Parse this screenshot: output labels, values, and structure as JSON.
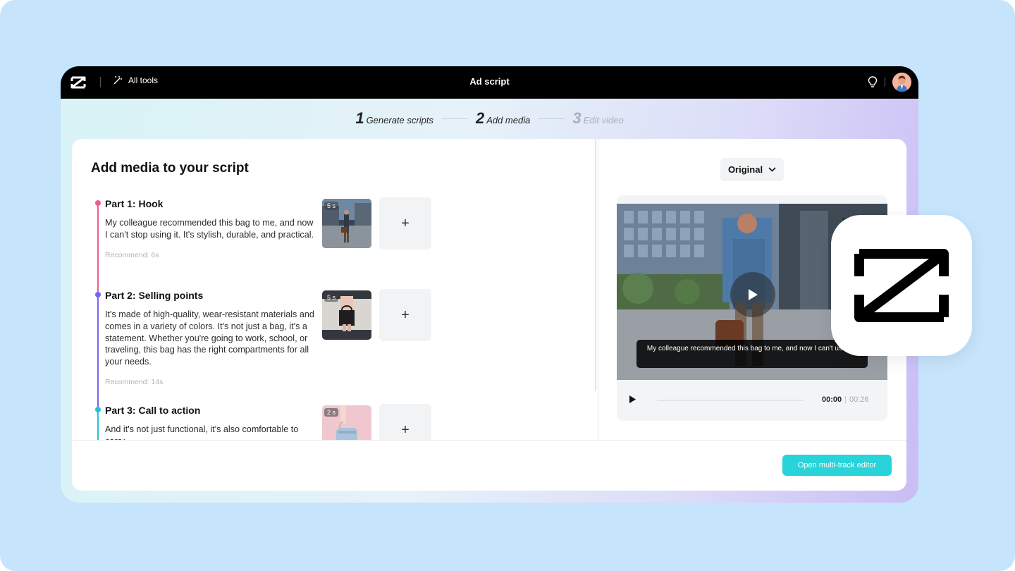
{
  "topbar": {
    "all_tools_label": "All tools",
    "title": "Ad script"
  },
  "steps": [
    {
      "number": "1",
      "label": "Generate scripts",
      "state": "done"
    },
    {
      "number": "2",
      "label": "Add media",
      "state": "active"
    },
    {
      "number": "3",
      "label": "Edit video",
      "state": "inactive"
    }
  ],
  "main": {
    "heading": "Add media to your script",
    "parts": [
      {
        "title": "Part 1: Hook",
        "text": "My colleague recommended this bag to me, and now I can't stop using it. It's stylish, durable, and practical.",
        "recommend": "Recommend: 6s",
        "duration": "5 s",
        "color": "#f05a8e"
      },
      {
        "title": "Part 2: Selling points",
        "text": "It's made of high-quality, wear-resistant materials and comes in a variety of colors. It's not just a bag, it's a statement. Whether you're going to work, school, or traveling, this bag has the right compartments for all your needs.",
        "recommend": "Recommend: 14s",
        "duration": "5 s",
        "color": "#7a63f0"
      },
      {
        "title": "Part 3: Call to action",
        "text": "And it's not just functional, it's also comfortable to carry.",
        "recommend": "",
        "duration": "2 s",
        "color": "#23c3d6"
      }
    ],
    "add_symbol": "+"
  },
  "preview": {
    "aspect_label": "Original",
    "caption": "My colleague recommended this bag to me, and now I can't using it",
    "current_time": "00:00",
    "total_time": "00:26",
    "progress": 0
  },
  "footer": {
    "open_editor_label": "Open multi-track editor"
  },
  "colors": {
    "accent": "#28d4d9",
    "background": "#c6e4fb",
    "topbar": "#000000"
  }
}
